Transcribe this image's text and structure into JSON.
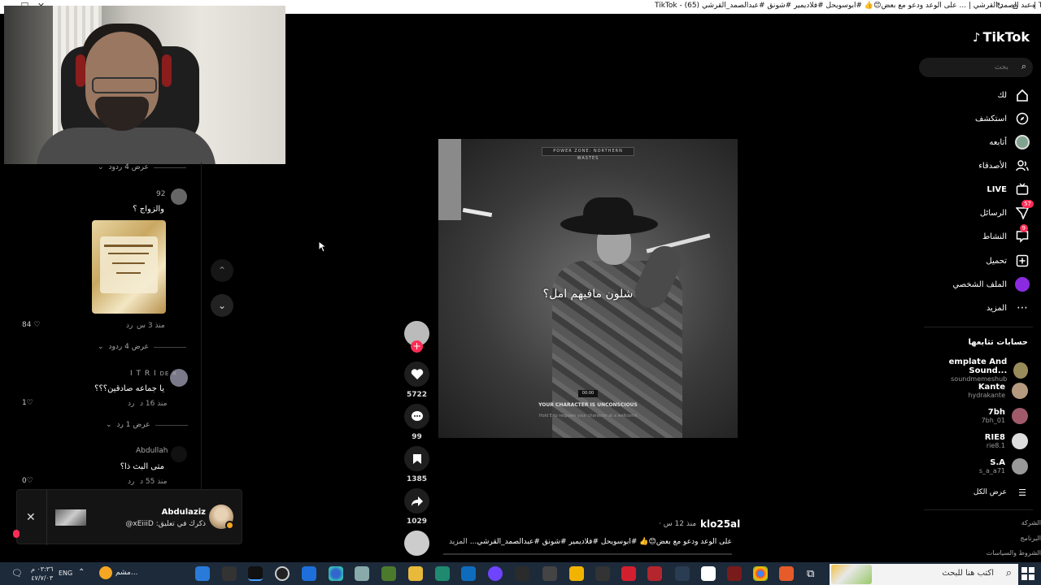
{
  "window": {
    "title": "TikTok - (65) عبد الصمد القرشي | ... على الوعد ودعو مع بعض😊👍 #ابوسويحل #فلاديمير #شونق #عبدالصمد_القرشي | TikTok"
  },
  "comments": {
    "top_reply_toggle": "عرض 4 ردود",
    "items": [
      {
        "user": "92",
        "text": "والزواج ؟",
        "time": "منذ 3 س",
        "reply_label": "رد",
        "likes": "84",
        "reply_toggle": "عرض 4 ردود"
      },
      {
        "user": "I T R I",
        "user_suffix": "DE ✕",
        "text": "يا جماعه صادقين؟؟؟",
        "time": "منذ 16 د",
        "reply_label": "رد",
        "likes": "1",
        "reply_toggle": "عرض 1 رد"
      },
      {
        "user": "Abdullah",
        "text": "متى البث ذا؟",
        "time": "منذ 55 د",
        "reply_label": "رد",
        "likes": "0"
      }
    ]
  },
  "notification": {
    "name": "Abdulaziz",
    "text": "ذكرك في تعليق: xEiiiD@"
  },
  "video": {
    "hud": "POWER ZONE: NORTHERN WASTES",
    "subtitle": "شلون مافيهم امل؟",
    "timer": "00:00",
    "status": "YOUR CHARACTER IS UNCONSCIOUS",
    "hint": "Hold  E  to respawn your character at a wellcome"
  },
  "actions": {
    "likes": "5722",
    "comments": "99",
    "saves": "1385",
    "shares": "1029"
  },
  "post": {
    "author": "klo25al",
    "time": "منذ 12 س ·",
    "caption": "على الوعد ودعو مع بعض😊👍 #ابوسويحل #فلاديمير #شونق #عبدالصمد_القرشي...",
    "more": "المزيد"
  },
  "sidebar": {
    "logo": "TikTok",
    "search_placeholder": "بحث",
    "nav": [
      {
        "label": "لك",
        "icon": "home-icon"
      },
      {
        "label": "استكشف",
        "icon": "compass-icon"
      },
      {
        "label": "أتابعه",
        "icon": "avatar-icon"
      },
      {
        "label": "الأصدقاء",
        "icon": "friends-icon"
      },
      {
        "label": "LIVE",
        "icon": "live-icon"
      },
      {
        "label": "الرسائل",
        "icon": "messages-icon",
        "badge": "57"
      },
      {
        "label": "النشاط",
        "icon": "activity-icon",
        "badge": "9"
      },
      {
        "label": "تحميل",
        "icon": "upload-icon"
      },
      {
        "label": "الملف الشخصي",
        "icon": "profile-icon"
      },
      {
        "label": "المزيد",
        "icon": "more-icon"
      }
    ],
    "following_title": "حسابات تتابعها",
    "following": [
      {
        "name": "emplate And Sound...",
        "handle": "soundmemeshub"
      },
      {
        "name": "Kante",
        "handle": "hydrakante"
      },
      {
        "name": "7bh",
        "handle": "7bh_01"
      },
      {
        "name": "RIE8",
        "handle": "rie8.1"
      },
      {
        "name": "S.A",
        "handle": "s_a_a71"
      }
    ],
    "see_all": "عرض الكل",
    "footer": [
      "الشركة",
      "البرنامج",
      "الشروط والسياسات"
    ]
  },
  "taskbar": {
    "search_placeholder": "اكتب هنا للبحث",
    "lang": "ENG",
    "time": "٠٣:٣٦ م",
    "date": "٤٧/٧/٠٣",
    "browser_label": "مشم..."
  },
  "colors": {
    "accent": "#fe2c55",
    "background": "#000000",
    "taskbar": "#1c2a3a"
  }
}
